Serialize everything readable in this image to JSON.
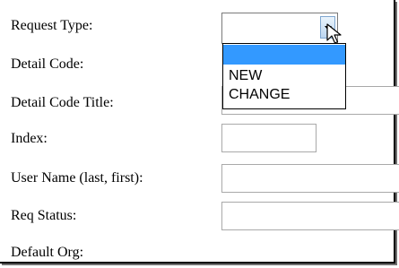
{
  "form": {
    "labels": {
      "request_type": "Request Type:",
      "detail_code": "Detail Code:",
      "detail_code_title": "Detail Code Title:",
      "index": "Index:",
      "user_name": "User Name (last, first):",
      "req_status": "Req Status:",
      "default_org": "Default Org:"
    },
    "request_type": {
      "selected_value": "",
      "options": [
        "",
        "NEW",
        "CHANGE"
      ]
    },
    "fields": {
      "detail_code_title": "",
      "index": "",
      "user_name": "",
      "req_status": ""
    }
  },
  "colors": {
    "highlight": "#3399ff",
    "input_border": "#a9a9a9"
  },
  "icons": {
    "select_arrow": "chevron-down-icon",
    "cursor": "mouse-pointer-icon"
  }
}
